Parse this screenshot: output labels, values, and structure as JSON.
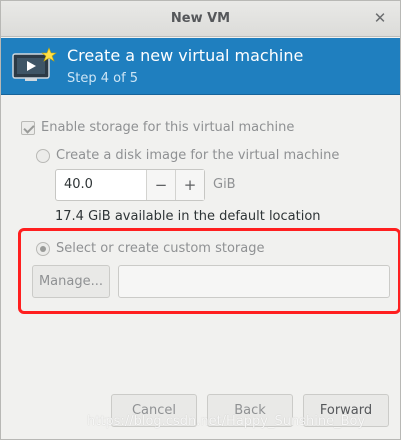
{
  "window": {
    "title": "New VM"
  },
  "header": {
    "title": "Create a new virtual machine",
    "step": "Step 4 of 5"
  },
  "storage": {
    "enable_label": "Enable storage for this virtual machine",
    "enable_checked": true,
    "disk_image_label": "Create a disk image for the virtual machine",
    "disk_size_value": "40.0",
    "unit": "GiB",
    "available_text": "17.4 GiB available in the default location",
    "custom_label": "Select or create custom storage",
    "custom_selected": true,
    "manage_label": "Manage...",
    "path_value": ""
  },
  "buttons": {
    "minus": "−",
    "plus": "+",
    "cancel": "Cancel",
    "back": "Back",
    "forward": "Forward"
  },
  "watermark": "https://blog.csdn.net/Happy_Sunshine_Boy",
  "icons": {
    "close": "close-icon",
    "header": "vm-monitor-icon"
  },
  "colors": {
    "header_bg": "#1f7fbf",
    "highlight": "#ff1f1f"
  }
}
